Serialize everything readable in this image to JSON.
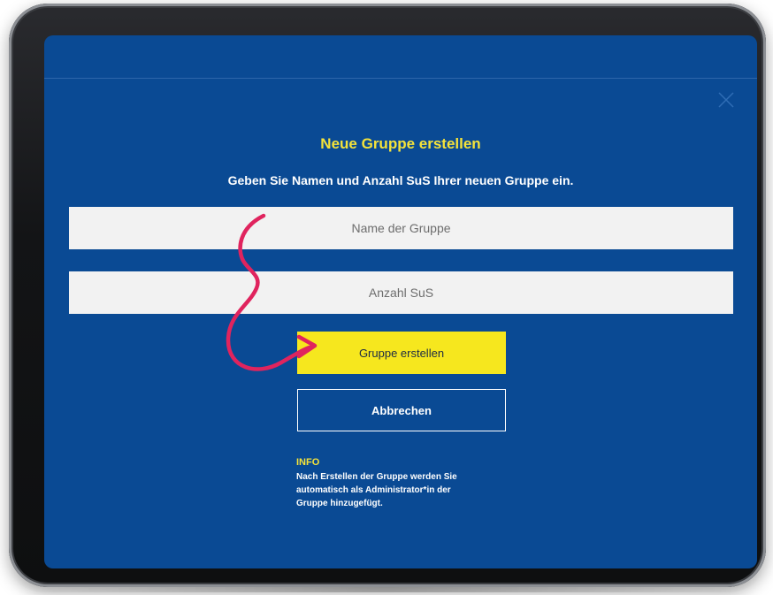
{
  "dialog": {
    "title": "Neue Gruppe erstellen",
    "subtitle": "Geben Sie Namen und Anzahl SuS Ihrer neuen Gruppe ein."
  },
  "form": {
    "group_name_placeholder": "Name der Gruppe",
    "count_placeholder": "Anzahl SuS"
  },
  "buttons": {
    "create_label": "Gruppe erstellen",
    "cancel_label": "Abbrechen"
  },
  "info": {
    "heading": "INFO",
    "text_lines": [
      "Nach Erstellen der Gruppe werden Sie",
      "automatisch als Administrator*in der",
      "Gruppe hinzugefügt."
    ]
  },
  "icons": {
    "close": "close-icon",
    "annotation_arrow": "curved-arrow-icon"
  },
  "colors": {
    "background": "#0a4a94",
    "accent_yellow": "#f6e71e",
    "title_yellow": "#f5e33a",
    "arrow": "#e0245e",
    "field": "#f2f2f2"
  }
}
